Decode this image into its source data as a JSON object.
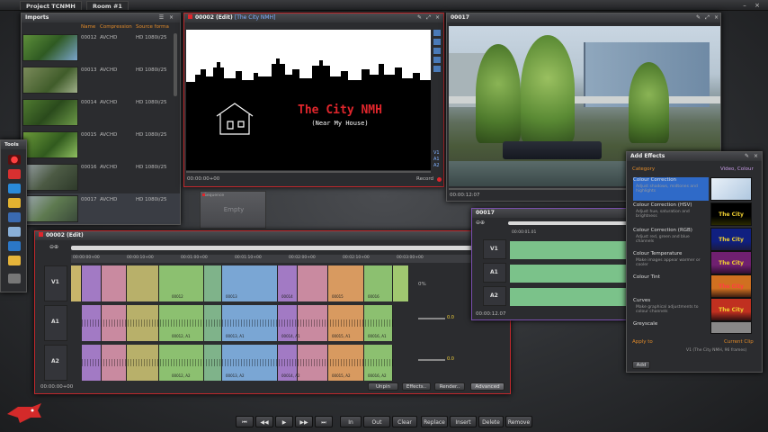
{
  "app": {
    "tabs": [
      "Project TCNMH",
      "Room #1"
    ],
    "window_controls": [
      "–",
      "×"
    ]
  },
  "imports": {
    "title": "Imports",
    "headers": [
      "Name",
      "Compression",
      "Source forma"
    ],
    "rows": [
      {
        "name": "00012",
        "compression": "AVCHD",
        "format": "HD 1080i/25"
      },
      {
        "name": "00013",
        "compression": "AVCHD",
        "format": "HD 1080i/25"
      },
      {
        "name": "00014",
        "compression": "AVCHD",
        "format": "HD 1080i/25"
      },
      {
        "name": "00015",
        "compression": "AVCHD",
        "format": "HD 1080i/25"
      },
      {
        "name": "00016",
        "compression": "AVCHD",
        "format": "HD 1080i/25"
      },
      {
        "name": "00017",
        "compression": "AVCHD",
        "format": "HD 1080i/25"
      }
    ]
  },
  "viewer1": {
    "title": "00002 (Edit)",
    "subtitle": "[The City NMH]",
    "video_title": "The City NMH",
    "video_subtitle": "(Near My House)",
    "timecode": "00:00:00+00",
    "record_label": "Record",
    "track_tags": [
      "V1",
      "A1",
      "A2"
    ]
  },
  "viewer2": {
    "title": "00017",
    "timecode": "00:00:12:07"
  },
  "empty_bin": {
    "label": "Empty",
    "tag": "Sequence"
  },
  "tools": {
    "title": "Tools"
  },
  "timeline": {
    "title": "00002 (Edit)",
    "ruler": [
      "00:00:00+00",
      "00:00:10+00",
      "00:01:00+00",
      "00:01:10+00",
      "00:02:00+00",
      "00:02:10+00",
      "00:03:00+00"
    ],
    "tracks": [
      {
        "label": "V1"
      },
      {
        "label": "A1"
      },
      {
        "label": "A2"
      }
    ],
    "percent": "0%",
    "level_a1": "0.0",
    "level_a2": "0.0",
    "clips_v1": [
      "00012",
      "00013",
      "00014",
      "00015",
      "00016"
    ],
    "clips_a": [
      "00012, A1",
      "00013, A1",
      "00014, A1",
      "00015, A1",
      "00016, A1"
    ],
    "clips_a2": [
      "00012, A2",
      "00013, A2",
      "00014, A2",
      "00015, A2",
      "00016, A2"
    ],
    "timecode": "00:00:00+00",
    "buttons": [
      "Unpin",
      "Effects..",
      "Render..",
      "Advanced"
    ]
  },
  "trim": {
    "title": "00017",
    "ruler": "00:00:01.01",
    "tracks": [
      "V1",
      "A1",
      "A2"
    ],
    "timecode": "00:00:12.07"
  },
  "effects": {
    "title": "Add Effects",
    "category_label": "Category",
    "category_value": "Video, Colour",
    "items": [
      {
        "name": "Colour Correction",
        "desc": "Adjust shadows, midtones and highlights"
      },
      {
        "name": "Colour Correction (HSV)",
        "desc": "Adjust hue, saturation and brightness"
      },
      {
        "name": "Colour Correction (RGB)",
        "desc": "Adjust red, green and blue channels"
      },
      {
        "name": "Colour Temperature",
        "desc": "Make images appear warmer or cooler"
      },
      {
        "name": "Colour Tint",
        "desc": ""
      },
      {
        "name": "Curves",
        "desc": "Make graphical adjustments to colour channels"
      },
      {
        "name": "Greyscale",
        "desc": ""
      }
    ],
    "apply_label": "Apply to",
    "apply_value": "Current Clip",
    "apply_target": "V1 (The City NMH, 96 frames)",
    "add_button": "Add",
    "swatch_text": "The City"
  },
  "transport": {
    "buttons": [
      "⏮",
      "◀◀",
      "▶",
      "▶▶",
      "⏭",
      "In",
      "Out",
      "Clear",
      "Replace",
      "Insert",
      "Delete",
      "Remove"
    ]
  }
}
